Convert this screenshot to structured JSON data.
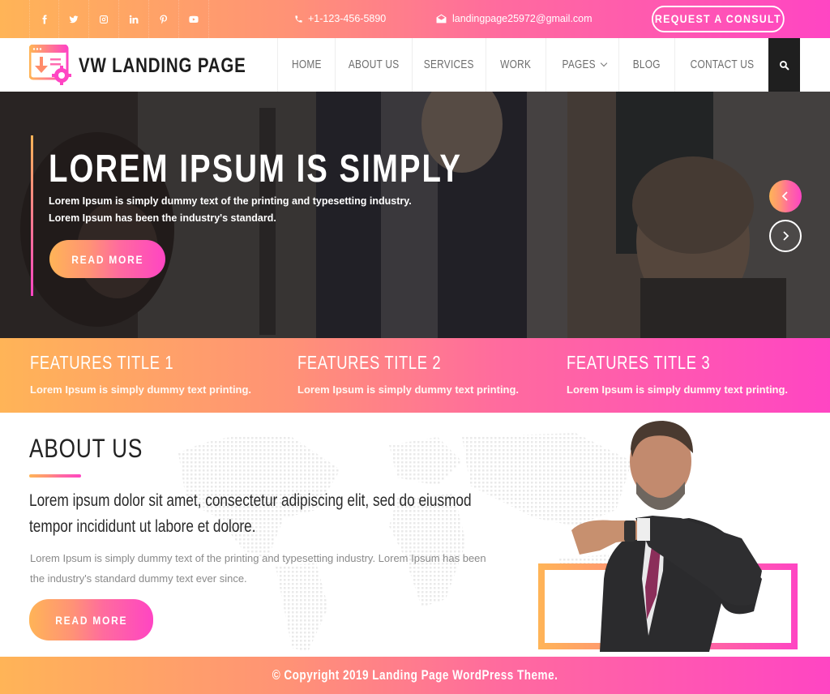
{
  "topbar": {
    "social": [
      {
        "name": "facebook-icon"
      },
      {
        "name": "twitter-icon"
      },
      {
        "name": "instagram-icon"
      },
      {
        "name": "linkedin-icon"
      },
      {
        "name": "pinterest-icon"
      },
      {
        "name": "youtube-icon"
      }
    ],
    "phone_icon": "phone-icon",
    "phone": "+1-123-456-5890",
    "email_icon": "envelope-icon",
    "email": "landingpage25972@gmail.com",
    "cta_label": "REQUEST A CONSULT"
  },
  "nav": {
    "brand": "VW LANDING PAGE",
    "items": [
      {
        "label": "HOME"
      },
      {
        "label": "ABOUT US"
      },
      {
        "label": "SERVICES"
      },
      {
        "label": "WORK"
      },
      {
        "label": "PAGES",
        "has_dropdown": true
      },
      {
        "label": "BLOG"
      },
      {
        "label": "CONTACT US"
      }
    ],
    "search_icon": "search-icon"
  },
  "hero": {
    "title": "LOREM IPSUM IS SIMPLY",
    "line1": "Lorem Ipsum is simply dummy text of the printing and typesetting industry.",
    "line2": "Lorem Ipsum has been the industry's standard.",
    "button": "READ MORE",
    "prev_icon": "chevron-left-icon",
    "next_icon": "chevron-right-icon"
  },
  "features": [
    {
      "title": "FEATURES TITLE 1",
      "text": "Lorem Ipsum is simply dummy text printing."
    },
    {
      "title": "FEATURES TITLE 2",
      "text": "Lorem Ipsum is simply dummy text printing."
    },
    {
      "title": "FEATURES TITLE 3",
      "text": "Lorem Ipsum is simply dummy text printing."
    }
  ],
  "about": {
    "heading": "ABOUT US",
    "lead": "Lorem ipsum dolor sit amet, consectetur adipiscing elit, sed do eiusmod tempor incididunt ut labore et dolore.",
    "body": "Lorem Ipsum is simply dummy text of the printing and typesetting industry. Lorem Ipsum has been the industry's standard dummy text ever since.",
    "button": "READ MORE"
  },
  "footer": {
    "copyright": "© Copyright 2019 Landing Page WordPress Theme."
  },
  "colors": {
    "gradient_start": "#ffb457",
    "gradient_end": "#ff45c3",
    "dark": "#1f1f1f",
    "nav_text": "#6d6d6d"
  }
}
